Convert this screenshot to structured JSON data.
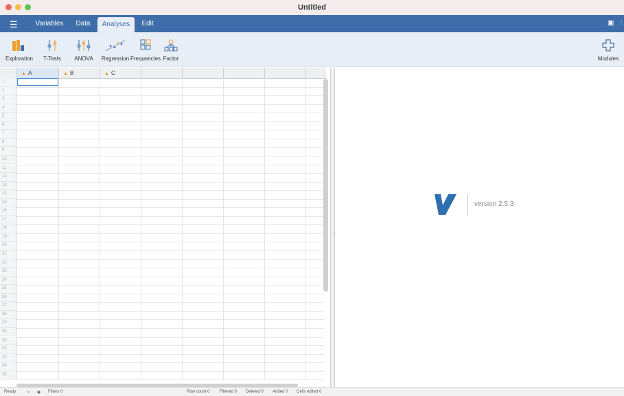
{
  "window": {
    "title": "Untitled"
  },
  "menubar": {
    "menu_icon": "hamburger-icon",
    "tabs": [
      {
        "label": "Variables"
      },
      {
        "label": "Data"
      },
      {
        "label": "Analyses"
      },
      {
        "label": "Edit"
      }
    ],
    "active_tab": "Analyses"
  },
  "ribbon": {
    "buttons": [
      {
        "label": "Exploration",
        "icon": "exploration-bar-icon"
      },
      {
        "label": "T-Tests",
        "icon": "ttests-icon"
      },
      {
        "label": "ANOVA",
        "icon": "anova-icon"
      },
      {
        "label": "Regression",
        "icon": "regression-icon"
      },
      {
        "label": "Frequencies",
        "icon": "frequencies-icon"
      },
      {
        "label": "Factor",
        "icon": "factor-icon"
      }
    ],
    "modules_label": "Modules"
  },
  "sheet": {
    "columns": [
      {
        "name": "A"
      },
      {
        "name": "B"
      },
      {
        "name": "C"
      }
    ],
    "rows": [
      "1",
      "2",
      "3",
      "4",
      "5",
      "6",
      "7",
      "8",
      "9",
      "10",
      "11",
      "12",
      "13",
      "14",
      "15",
      "16",
      "17",
      "18",
      "19",
      "20",
      "21",
      "22",
      "23",
      "24",
      "25",
      "26",
      "27",
      "28",
      "29",
      "30",
      "31",
      "32",
      "33",
      "34",
      "35"
    ]
  },
  "results": {
    "version": "version 2.5.3"
  },
  "status": {
    "ready": "Ready",
    "filters": "Filters 0",
    "row_count": "Row count 0",
    "filtered": "Filtered 0",
    "deleted": "Deleted 0",
    "added": "Added 0",
    "cells_edited": "Cells edited 0"
  },
  "colors": {
    "accent": "#3e6da9",
    "ribbon_bg": "#e8eef6",
    "logo": "#2f6fb0"
  }
}
